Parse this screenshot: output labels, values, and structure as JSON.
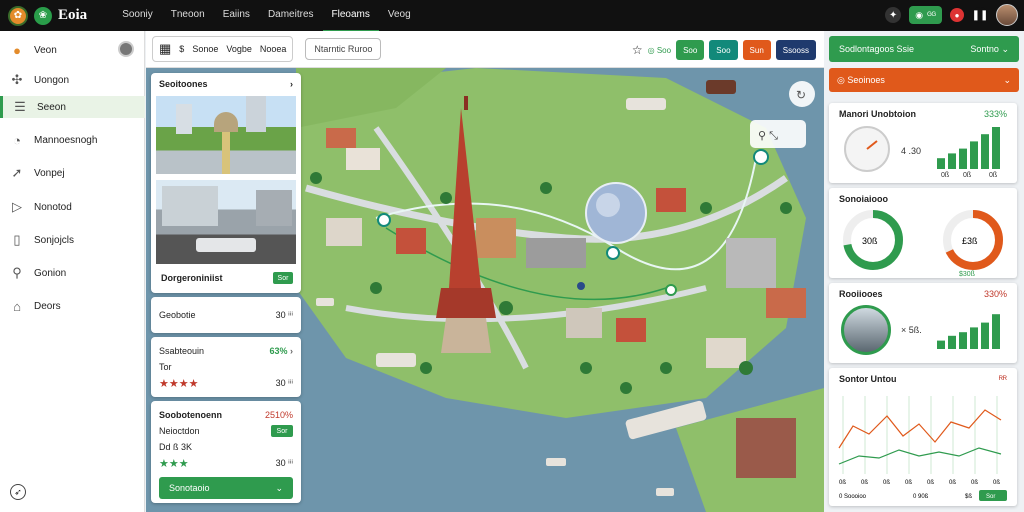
{
  "topbar": {
    "brand": "Eoia",
    "nav": [
      "Sooniy",
      "Tneoon",
      "Eaiins",
      "Dameitres",
      "Fleoams",
      "Veog"
    ],
    "active_nav_index": 4,
    "pill_label": "ᴳᴳ"
  },
  "sidebar": {
    "items": [
      {
        "label": "Veon",
        "icon": "pin-icon"
      },
      {
        "label": "Uongon",
        "icon": "settings-icon"
      },
      {
        "label": "Seeon",
        "icon": "list-icon"
      },
      {
        "label": "Mannoesnogh",
        "icon": "globe-icon"
      },
      {
        "label": "Vonpej",
        "icon": "share-icon"
      },
      {
        "label": "Nonotod",
        "icon": "document-icon"
      },
      {
        "label": "Sonjojcls",
        "icon": "clipboard-icon"
      },
      {
        "label": "Gonion",
        "icon": "search-icon"
      },
      {
        "label": "Deors",
        "icon": "bag-icon"
      }
    ],
    "active_index": 2
  },
  "toolbar": {
    "group_labels": [
      "Sonoe",
      "Vogbe",
      "Nooea"
    ],
    "search_field": "Ntarntic Ruroo",
    "buttons": [
      {
        "label": "Soo",
        "color": "#2f9b4e"
      },
      {
        "label": "Soo",
        "color": "#2f9b4e"
      },
      {
        "label": "Soo",
        "color": "#12897a"
      },
      {
        "label": "Sun",
        "color": "#e0591b"
      },
      {
        "label": "Ssooss",
        "color": "#1f3a6d"
      }
    ]
  },
  "left_panel": {
    "card1_title": "Seoitoones",
    "card1_caption": "Dorgeroniniist",
    "card1_tag": "Sor",
    "card2_row_label": "Geobotie",
    "card2_row_value": "30 ⁱⁱⁱ",
    "card3_title": "Ssabteouin",
    "card3_value": "63%",
    "card3_sub": "Tor",
    "card3_rating_value": "30 ⁱⁱⁱ",
    "card4_title": "Soobotenoenn",
    "card4_value": "2510%",
    "card4_sub": "Neioctdon",
    "card4_sub2": "Dd ß 3K",
    "card4_tag": "Sor",
    "card4_rating_value": "30 ⁱⁱⁱ",
    "dropdown_label": "Sonotaoio"
  },
  "right_panel": {
    "top_bar_label": "Sodlontagoos Ssie",
    "top_bar_right": "Sontno",
    "orange_bar_label": "Seoinoes",
    "card1_title": "Manori Unobtoion",
    "card1_pct": "333%",
    "card1_readout": "4 .30",
    "card1_bars": [
      18,
      26,
      34,
      46,
      58,
      70
    ],
    "card1_bar_labels": [
      "0ß",
      "0ß",
      "0ß"
    ],
    "card2_title": "Sonoiaiooo",
    "donut1_value": "30ß",
    "donut1_fraction": 0.72,
    "donut2_value": "£3ß",
    "donut2_fraction": 0.68,
    "donut2_caption": "$30ß",
    "card3_title": "Rooiiooes",
    "card3_pct": "330%",
    "card3_readout": "× 5ß.",
    "card3_bars": [
      14,
      22,
      28,
      36,
      44,
      58
    ],
    "card4_title": "Sontor Untou",
    "card4_pct": "ᴿᴿ",
    "card4_axis_labels": [
      "0ß",
      "0ß",
      "0ß",
      "0ß",
      "0ß",
      "0ß",
      "0ß",
      "0ß"
    ],
    "card4_bottom_labels": [
      "0 Soooioo",
      "0 90ß",
      "$ß"
    ],
    "card4_tag": "Sor"
  },
  "colors": {
    "accent_green": "#2f9b4e",
    "orange": "#e0591b",
    "teal": "#12897a",
    "navy": "#1f3a6d",
    "water": "#6e95ab"
  }
}
